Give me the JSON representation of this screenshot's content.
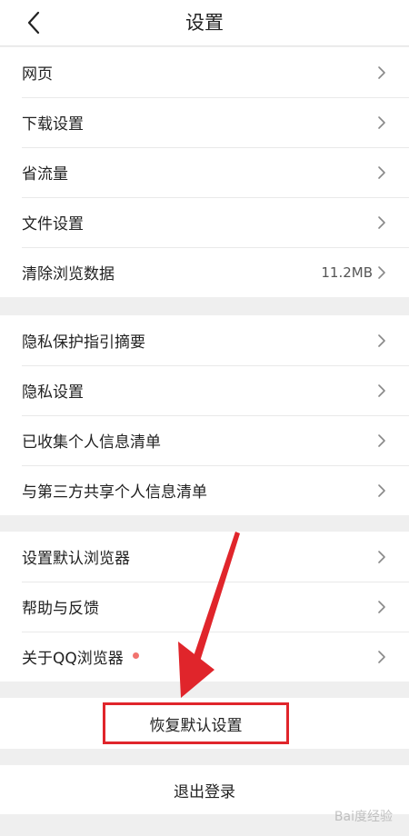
{
  "header": {
    "title": "设置"
  },
  "groups": [
    {
      "items": [
        {
          "label": "网页",
          "value": ""
        },
        {
          "label": "下载设置",
          "value": ""
        },
        {
          "label": "省流量",
          "value": ""
        },
        {
          "label": "文件设置",
          "value": ""
        },
        {
          "label": "清除浏览数据",
          "value": "11.2MB"
        }
      ]
    },
    {
      "items": [
        {
          "label": "隐私保护指引摘要"
        },
        {
          "label": "隐私设置"
        },
        {
          "label": "已收集个人信息清单"
        },
        {
          "label": "与第三方共享个人信息清单"
        }
      ]
    },
    {
      "items": [
        {
          "label": "设置默认浏览器"
        },
        {
          "label": "帮助与反馈"
        },
        {
          "label": "关于QQ浏览器"
        }
      ]
    }
  ],
  "actions": {
    "reset_label": "恢复默认设置",
    "logout_label": "退出登录"
  },
  "annotation": {
    "highlight_color": "#e0252b",
    "arrow_color": "#e0252b"
  },
  "watermark": {
    "text": "Bai度经验"
  },
  "colors": {
    "background": "#efefef",
    "surface": "#ffffff",
    "text": "#222222",
    "badge_dot": "#f1736e"
  },
  "icons": {
    "back": "chevron-left-icon",
    "row_arrow": "chevron-right-icon"
  }
}
